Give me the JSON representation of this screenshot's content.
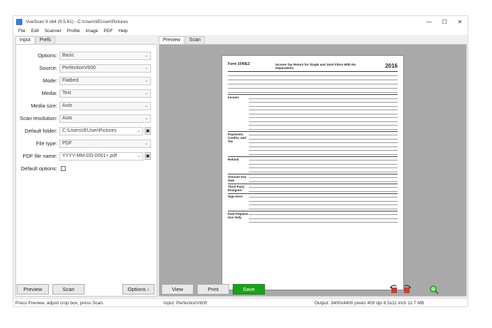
{
  "window": {
    "title": "VueScan 9 x64 (9.5.61) - C:\\Users\\IEUser\\Pictures",
    "controls": {
      "minimize": "—",
      "maximize": "☐",
      "close": "✕"
    }
  },
  "menu": [
    "File",
    "Edit",
    "Scanner",
    "Profile",
    "Image",
    "PDF",
    "Help"
  ],
  "left_tabs": [
    "Input",
    "Prefs"
  ],
  "right_tabs": [
    "Preview",
    "Scan"
  ],
  "fields": {
    "options": {
      "label": "Options:",
      "value": "Basic"
    },
    "source": {
      "label": "Source:",
      "value": "PerfectionV600"
    },
    "mode": {
      "label": "Mode:",
      "value": "Flatbed"
    },
    "media": {
      "label": "Media:",
      "value": "Text"
    },
    "media_size": {
      "label": "Media size:",
      "value": "Auto"
    },
    "scan_resolution": {
      "label": "Scan resolution:",
      "value": "Auto"
    },
    "default_folder": {
      "label": "Default folder:",
      "value": "C:\\Users\\IEUser\\Pictures"
    },
    "file_type": {
      "label": "File type:",
      "value": "PDF"
    },
    "pdf_file_name": {
      "label": "PDF file name:",
      "value": "YYYY-MM-DD-0001+.pdf"
    },
    "default_options": {
      "label": "Default options:"
    }
  },
  "document": {
    "form_id": "Form 1040EZ",
    "form_title": "Income Tax Return for Single and Joint Filers With No Dependents",
    "form_year": "2016",
    "sections": [
      "Income",
      "Payments, Credits, and Tax",
      "Refund",
      "Amount You Owe",
      "Third Party Designee",
      "Sign Here",
      "Paid Preparer Use Only"
    ]
  },
  "buttons": {
    "preview": "Preview",
    "scan": "Scan",
    "options": "Options ‹",
    "view": "View",
    "print": "Print",
    "save": "Save"
  },
  "status": {
    "left": "Press Preview, adjust crop box, press Scan.",
    "middle": "Input: PerfectionV600",
    "right": "Output: 3400x4400 pixels 400 dpi 8.5x11 inch 11.7 MB"
  },
  "colors": {
    "accent_save": "#1aa21a",
    "preview_bg": "#a9a9a9"
  }
}
